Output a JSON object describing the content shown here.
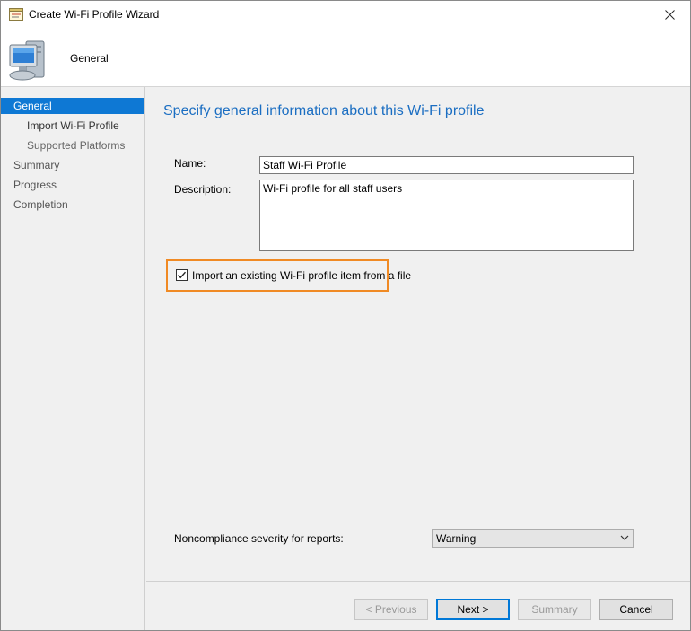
{
  "window": {
    "title": "Create Wi-Fi Profile Wizard",
    "app_icon": "wizard-icon",
    "close_glyph": "✕"
  },
  "header": {
    "title": "General",
    "icon": "computer-icon"
  },
  "nav": {
    "items": [
      {
        "label": "General",
        "active": true,
        "level": 0
      },
      {
        "label": "Import Wi-Fi Profile",
        "active": false,
        "level": 1
      },
      {
        "label": "Supported Platforms",
        "active": false,
        "level": 1
      },
      {
        "label": "Summary",
        "active": false,
        "level": 0
      },
      {
        "label": "Progress",
        "active": false,
        "level": 0
      },
      {
        "label": "Completion",
        "active": false,
        "level": 0
      }
    ]
  },
  "main": {
    "heading": "Specify general information about this Wi-Fi profile",
    "name_label": "Name:",
    "name_value": "Staff Wi-Fi Profile",
    "description_label": "Description:",
    "description_value": "Wi-Fi profile for all staff users",
    "import_checkbox_label": "Import an existing Wi-Fi profile item from a file",
    "import_checked": true,
    "severity_label": "Noncompliance severity for reports:",
    "severity_value": "Warning"
  },
  "footer": {
    "previous": "< Previous",
    "next": "Next >",
    "summary": "Summary",
    "cancel": "Cancel"
  },
  "colors": {
    "accent": "#0e78d4",
    "heading": "#1b6ec2",
    "highlight": "#f08a24"
  }
}
